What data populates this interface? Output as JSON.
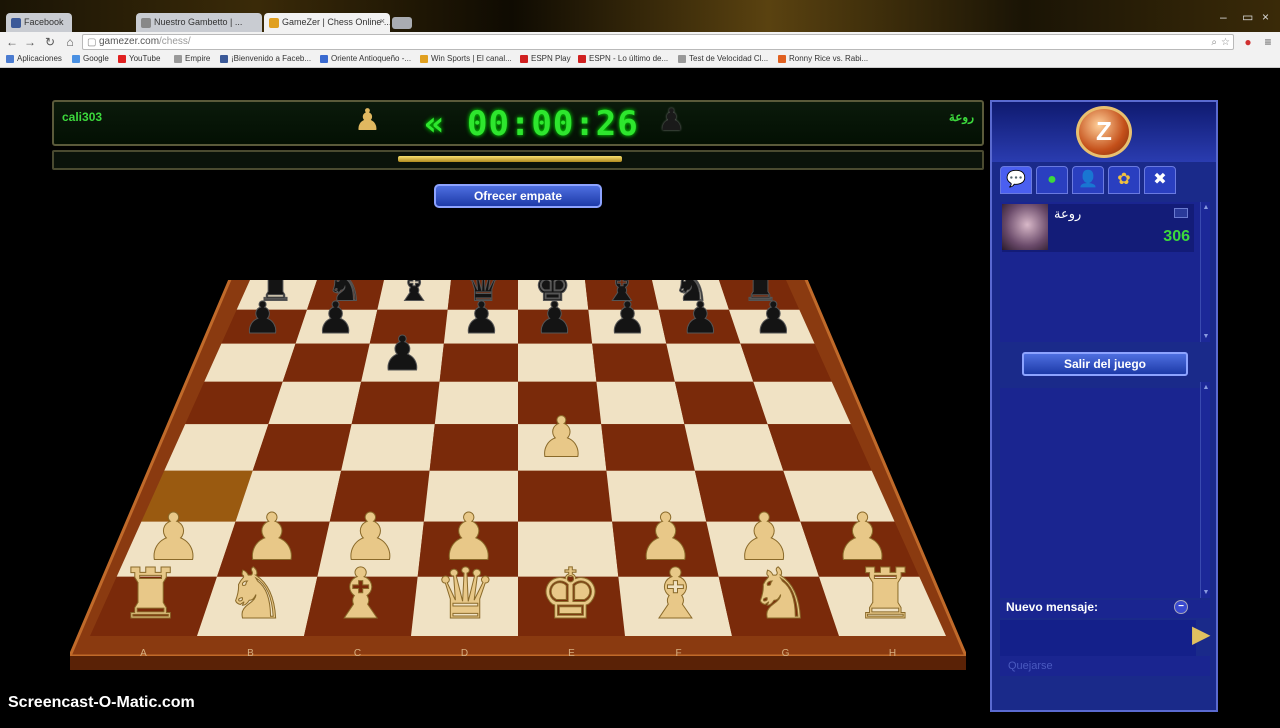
{
  "browser": {
    "tabs": [
      {
        "label": "Facebook",
        "color": "#3b5998",
        "active": false
      },
      {
        "label": "Nuestro Gambetto | ...",
        "color": "#888",
        "active": false
      },
      {
        "label": "GameZer | Chess Online ...",
        "color": "#e0a020",
        "active": true
      }
    ],
    "url_host": "gamezer.com",
    "url_path": "/chess/",
    "bookmarks": [
      {
        "label": "Aplicaciones",
        "color": "#4a7bd0"
      },
      {
        "label": "Google",
        "color": "#4a90e2"
      },
      {
        "label": "YouTube",
        "color": "#e02020"
      },
      {
        "label": "Empire",
        "color": "#999"
      },
      {
        "label": "¡Bienvenido a Faceb...",
        "color": "#3b5998"
      },
      {
        "label": "Oriente Antioqueño -...",
        "color": "#3a6ad0"
      },
      {
        "label": "Win Sports | El canal...",
        "color": "#e0a020"
      },
      {
        "label": "ESPN Play",
        "color": "#d02020"
      },
      {
        "label": "ESPN - Lo último de...",
        "color": "#d02020"
      },
      {
        "label": "Test de Velocidad Cl...",
        "color": "#999"
      },
      {
        "label": "Ronny Rice vs. Rabi...",
        "color": "#e06020"
      }
    ]
  },
  "game": {
    "player_left": "cali303",
    "player_right": "روعة",
    "clock": "00:00:26",
    "clock_arrows": "«",
    "offer_draw": "Ofrecer empate",
    "files": [
      "A",
      "B",
      "C",
      "D",
      "E",
      "F",
      "G",
      "H"
    ],
    "board": [
      [
        "r",
        "n",
        "b",
        "q",
        "k",
        "b",
        "n",
        "r"
      ],
      [
        "p",
        "p",
        "",
        "p",
        "p",
        "p",
        "p",
        "p"
      ],
      [
        "",
        "",
        "p",
        "",
        "",
        "",
        "",
        ""
      ],
      [
        "",
        "",
        "",
        "",
        "",
        "",
        "",
        ""
      ],
      [
        "",
        "",
        "",
        "",
        "P",
        "",
        "",
        ""
      ],
      [
        "",
        "",
        "",
        "",
        "",
        "",
        "",
        ""
      ],
      [
        "P",
        "P",
        "P",
        "P",
        "",
        "P",
        "P",
        "P"
      ],
      [
        "R",
        "N",
        "B",
        "Q",
        "K",
        "B",
        "N",
        "R"
      ]
    ],
    "highlight_square": "a3"
  },
  "panel": {
    "logo_letter": "Z",
    "tabs": [
      {
        "icon": "chat-icon",
        "glyph": "💬"
      },
      {
        "icon": "online-icon",
        "glyph": "●"
      },
      {
        "icon": "player-icon",
        "glyph": "👤"
      },
      {
        "icon": "friends-icon",
        "glyph": "✿"
      },
      {
        "icon": "settings-icon",
        "glyph": "✖"
      }
    ],
    "opponent_name": "روعة",
    "opponent_score": "306",
    "leave_game": "Salir del juego",
    "new_message": "Nuevo mensaje:",
    "report": "Quejarse"
  },
  "watermark": "Screencast-O-Matic.com"
}
